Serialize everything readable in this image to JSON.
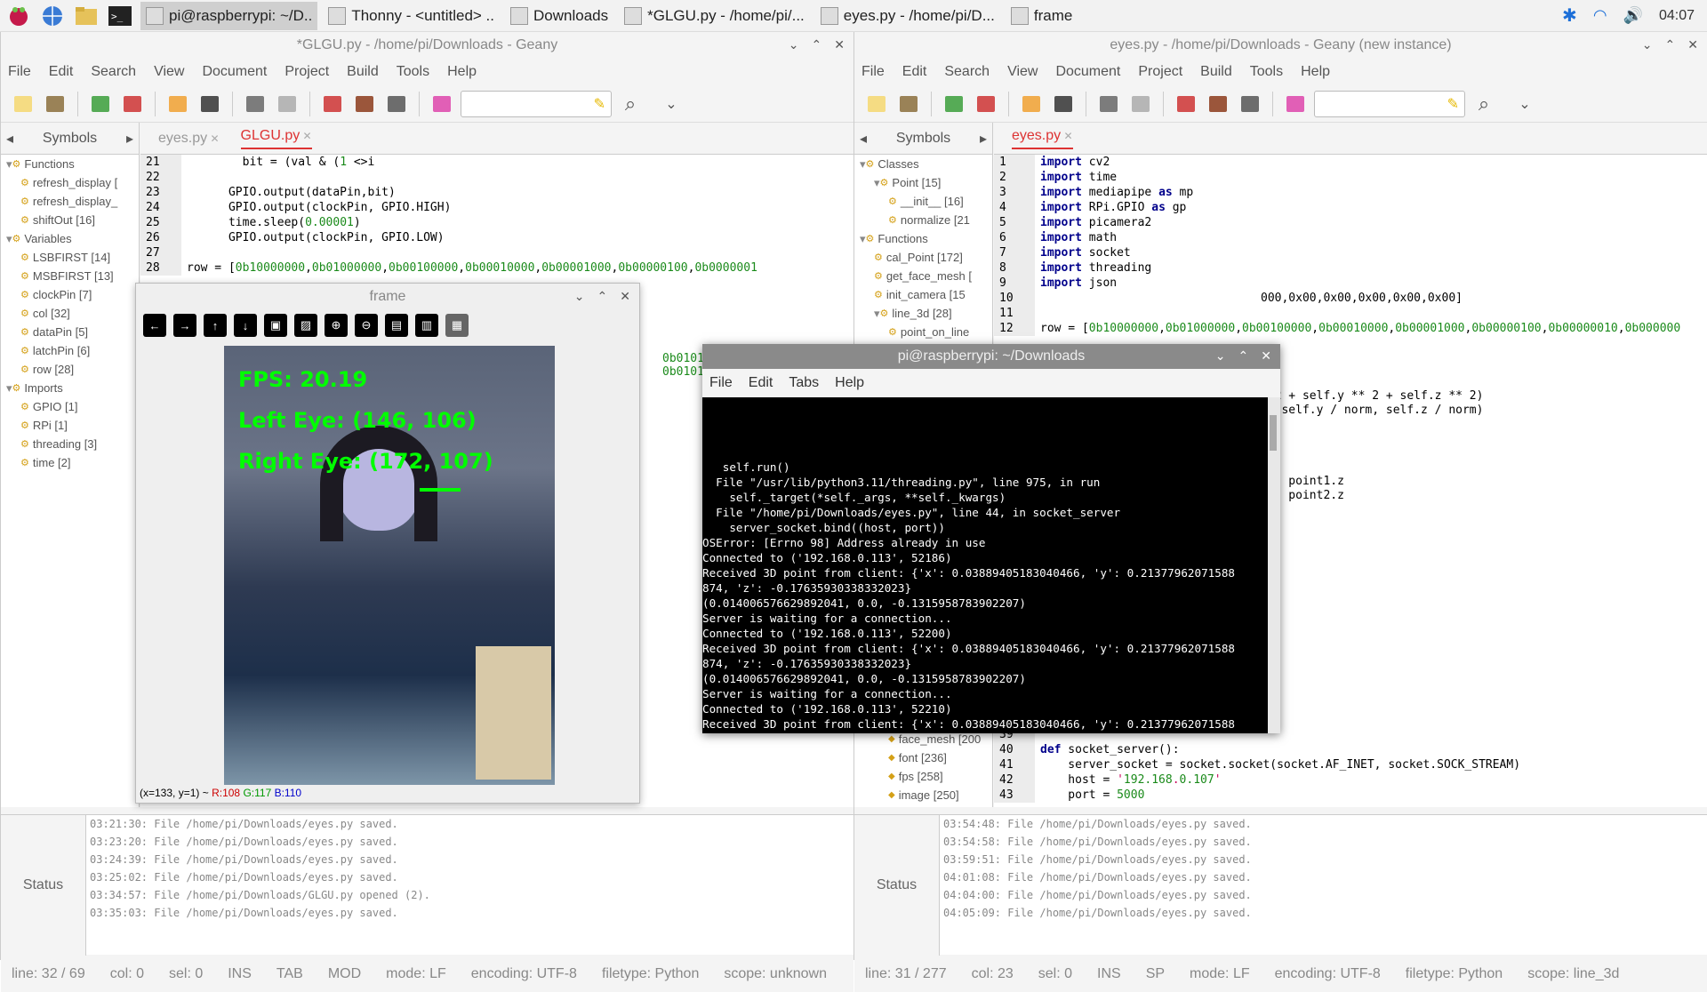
{
  "taskbar": {
    "tasks": [
      {
        "label": "pi@raspberrypi: ~/D..",
        "active": true
      },
      {
        "label": "Thonny  -  <untitled>  .."
      },
      {
        "label": "Downloads"
      },
      {
        "label": "*GLGU.py - /home/pi/..."
      },
      {
        "label": "eyes.py - /home/pi/D..."
      },
      {
        "label": "frame"
      }
    ],
    "clock": "04:07"
  },
  "left_geany": {
    "title": "*GLGU.py - /home/pi/Downloads - Geany",
    "menu": [
      "File",
      "Edit",
      "Search",
      "View",
      "Document",
      "Project",
      "Build",
      "Tools",
      "Help"
    ],
    "sidebar_tab": "Symbols",
    "tree": [
      {
        "label": "Functions",
        "level": 0,
        "kind": "group"
      },
      {
        "label": "refresh_display [",
        "level": 1
      },
      {
        "label": "refresh_display_",
        "level": 1
      },
      {
        "label": "shiftOut [16]",
        "level": 1
      },
      {
        "label": "Variables",
        "level": 0,
        "kind": "group"
      },
      {
        "label": "LSBFIRST [14]",
        "level": 1
      },
      {
        "label": "MSBFIRST [13]",
        "level": 1
      },
      {
        "label": "clockPin [7]",
        "level": 1
      },
      {
        "label": "col [32]",
        "level": 1
      },
      {
        "label": "dataPin [5]",
        "level": 1
      },
      {
        "label": "latchPin [6]",
        "level": 1
      },
      {
        "label": "row [28]",
        "level": 1
      },
      {
        "label": "Imports",
        "level": 0,
        "kind": "group"
      },
      {
        "label": "GPIO [1]",
        "level": 1
      },
      {
        "label": "RPi [1]",
        "level": 1
      },
      {
        "label": "threading [3]",
        "level": 1
      },
      {
        "label": "time [2]",
        "level": 1
      }
    ],
    "tabs": [
      "eyes.py",
      "GLGU.py"
    ],
    "active_tab": "GLGU.py",
    "code": [
      {
        "n": "21",
        "t": "        bit = (val & (1 <<i)) >>i"
      },
      {
        "n": "22",
        "t": ""
      },
      {
        "n": "23",
        "t": "      GPIO.output(dataPin,bit)"
      },
      {
        "n": "24",
        "t": "      GPIO.output(clockPin, GPIO.HIGH)"
      },
      {
        "n": "25",
        "t": "      time.sleep(0.00001)"
      },
      {
        "n": "26",
        "t": "      GPIO.output(clockPin, GPIO.LOW)"
      },
      {
        "n": "27",
        "t": ""
      },
      {
        "n": "28",
        "t": "row = [0b10000000,0b01000000,0b00100000,0b00010000,0b00001000,0b00000100,0b0000001"
      }
    ],
    "hidden_code_tail": "0b0101000100010001, 0b0101010",
    "messages": [
      "03:21:30: File /home/pi/Downloads/eyes.py saved.",
      "03:23:20: File /home/pi/Downloads/eyes.py saved.",
      "03:24:39: File /home/pi/Downloads/eyes.py saved.",
      "03:25:02: File /home/pi/Downloads/eyes.py saved.",
      "03:34:57: File /home/pi/Downloads/GLGU.py opened (2).",
      "03:35:03: File /home/pi/Downloads/eyes.py saved."
    ],
    "msg_tab": "Status",
    "status": [
      "line: 32 / 69",
      "col: 0",
      "sel: 0",
      "INS",
      "TAB",
      "MOD",
      "mode: LF",
      "encoding: UTF-8",
      "filetype: Python",
      "scope: unknown"
    ]
  },
  "right_geany": {
    "title": "eyes.py - /home/pi/Downloads - Geany (new instance)",
    "menu": [
      "File",
      "Edit",
      "Search",
      "View",
      "Document",
      "Project",
      "Build",
      "Tools",
      "Help"
    ],
    "sidebar_tab": "Symbols",
    "tree": [
      {
        "label": "Classes",
        "level": 0,
        "kind": "group"
      },
      {
        "label": "Point [15]",
        "level": 1,
        "kind": "group"
      },
      {
        "label": "__init__ [16]",
        "level": 2
      },
      {
        "label": "normalize [21",
        "level": 2
      },
      {
        "label": "Functions",
        "level": 0,
        "kind": "group"
      },
      {
        "label": "cal_Point [172]",
        "level": 1
      },
      {
        "label": "get_face_mesh [",
        "level": 1
      },
      {
        "label": "init_camera [15",
        "level": 1
      },
      {
        "label": "line_3d [28]",
        "level": 1,
        "kind": "group"
      },
      {
        "label": "point_on_line",
        "level": 2
      }
    ],
    "tree_bottom": [
      {
        "label": "face_mesh [200"
      },
      {
        "label": "font [236]"
      },
      {
        "label": "fps [258]"
      },
      {
        "label": "image [250]"
      }
    ],
    "tabs": [
      "eyes.py"
    ],
    "active_tab": "eyes.py",
    "code": [
      {
        "n": "1",
        "t": "import cv2"
      },
      {
        "n": "2",
        "t": "import time"
      },
      {
        "n": "3",
        "t": "import mediapipe as mp"
      },
      {
        "n": "4",
        "t": "import RPi.GPIO as gp"
      },
      {
        "n": "5",
        "t": "import picamera2"
      },
      {
        "n": "6",
        "t": "import math"
      },
      {
        "n": "7",
        "t": "import socket"
      },
      {
        "n": "8",
        "t": "import threading"
      },
      {
        "n": "9",
        "t": "import json"
      },
      {
        "n": "10",
        "t": ""
      },
      {
        "n": "11",
        "t": ""
      },
      {
        "n": "12",
        "t": "row = [0b10000000,0b01000000,0b00100000,0b00010000,0b00001000,0b00000100,0b00000010,0b000000"
      }
    ],
    "partial_lines": [
      "* 2 + self.y ** 2 + self.z ** 2)",
      "m, self.y / norm, self.z / norm)",
      ".y, point1.z",
      ".y, point2.z",
      "000,0x00,0x00,0x00,0x00,0x00]"
    ],
    "code_bottom": [
      {
        "n": "39",
        "t": ""
      },
      {
        "n": "40",
        "t": "def socket_server():"
      },
      {
        "n": "41",
        "t": "    server_socket = socket.socket(socket.AF_INET, socket.SOCK_STREAM)"
      },
      {
        "n": "42",
        "t": "    host = '192.168.0.107'"
      },
      {
        "n": "43",
        "t": "    port = 5000"
      }
    ],
    "messages": [
      "03:54:48: File /home/pi/Downloads/eyes.py saved.",
      "03:54:58: File /home/pi/Downloads/eyes.py saved.",
      "03:59:51: File /home/pi/Downloads/eyes.py saved.",
      "04:01:08: File /home/pi/Downloads/eyes.py saved.",
      "04:04:00: File /home/pi/Downloads/eyes.py saved.",
      "04:05:09: File /home/pi/Downloads/eyes.py saved."
    ],
    "msg_tab": "Status",
    "status": [
      "line: 31 / 277",
      "col: 23",
      "sel: 0",
      "INS",
      "SP",
      "mode: LF",
      "encoding: UTF-8",
      "filetype: Python",
      "scope: line_3d"
    ]
  },
  "frame_window": {
    "title": "frame",
    "fps": "FPS: 20.19",
    "left_eye": "Left Eye: (146, 106)",
    "right_eye": "Right Eye: (172, 107)",
    "status_pos": "(x=133, y=1) ~",
    "status_r": "R:108",
    "status_g": "G:117",
    "status_b": "B:110"
  },
  "terminal": {
    "title": "pi@raspberrypi: ~/Downloads",
    "menu": [
      "File",
      "Edit",
      "Tabs",
      "Help"
    ],
    "lines": [
      "   self.run()",
      "  File \"/usr/lib/python3.11/threading.py\", line 975, in run",
      "    self._target(*self._args, **self._kwargs)",
      "  File \"/home/pi/Downloads/eyes.py\", line 44, in socket_server",
      "    server_socket.bind((host, port))",
      "OSError: [Errno 98] Address already in use",
      "Connected to ('192.168.0.113', 52186)",
      "Received 3D point from client: {'x': 0.03889405183040466, 'y': 0.21377962071588",
      "874, 'z': -0.17635930338332023}",
      "(0.014006576629892041, 0.0, -0.1315958783902207)",
      "Server is waiting for a connection...",
      "Connected to ('192.168.0.113', 52200)",
      "Received 3D point from client: {'x': 0.03889405183040466, 'y': 0.21377962071588",
      "874, 'z': -0.17635930338332023}",
      "(0.014006576629892041, 0.0, -0.1315958783902207)",
      "Server is waiting for a connection...",
      "Connected to ('192.168.0.113', 52210)",
      "Received 3D point from client: {'x': 0.03889405183040466, 'y': 0.21377962071588"
    ]
  },
  "colors": {
    "accent_red": "#dd3333",
    "green_overlay": "#00ff00"
  }
}
